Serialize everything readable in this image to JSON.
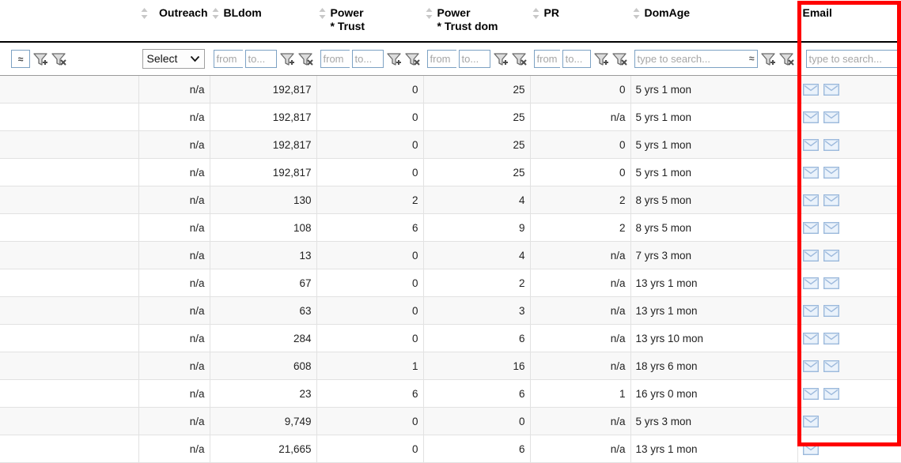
{
  "table": {
    "columns": [
      {
        "key": "check",
        "label": "",
        "align": "left",
        "sortable": false,
        "filter": "approx"
      },
      {
        "key": "outreach",
        "label": "Outreach",
        "align": "right",
        "sortable": true,
        "filter": "select"
      },
      {
        "key": "bldom",
        "label": "BLdom",
        "align": "left",
        "sortable": true,
        "filter": "range"
      },
      {
        "key": "pt",
        "label": "Power\n* Trust",
        "align": "left",
        "sortable": true,
        "filter": "range"
      },
      {
        "key": "ptd",
        "label": "Power\n* Trust dom",
        "align": "left",
        "sortable": true,
        "filter": "range"
      },
      {
        "key": "pr",
        "label": "PR",
        "align": "left",
        "sortable": true,
        "filter": "range"
      },
      {
        "key": "domage",
        "label": "DomAge",
        "align": "left",
        "sortable": true,
        "filter": "search"
      },
      {
        "key": "email",
        "label": "Email",
        "align": "left",
        "sortable": false,
        "filter": "search"
      }
    ],
    "filters": {
      "approx_label": "≈",
      "select_value": "Select",
      "select_caret": "⌵",
      "from_placeholder": "from",
      "to_placeholder": "to...",
      "search_placeholder": "type to search...",
      "search_tilde": "≈",
      "add_filter_icon": "filter-add-icon",
      "clear_filter_icon": "filter-clear-icon"
    },
    "na_text": "n/a",
    "envelope_icon": "envelope-icon",
    "rows": [
      {
        "check": "",
        "outreach": "n/a",
        "bldom": "192,817",
        "pt": "0",
        "ptd": "25",
        "pr": "0",
        "domage": "5 yrs 1 mon",
        "emails": 2
      },
      {
        "check": "",
        "outreach": "n/a",
        "bldom": "192,817",
        "pt": "0",
        "ptd": "25",
        "pr": "n/a",
        "domage": "5 yrs 1 mon",
        "emails": 2
      },
      {
        "check": "",
        "outreach": "n/a",
        "bldom": "192,817",
        "pt": "0",
        "ptd": "25",
        "pr": "0",
        "domage": "5 yrs 1 mon",
        "emails": 2
      },
      {
        "check": "",
        "outreach": "n/a",
        "bldom": "192,817",
        "pt": "0",
        "ptd": "25",
        "pr": "0",
        "domage": "5 yrs 1 mon",
        "emails": 2
      },
      {
        "check": "",
        "outreach": "n/a",
        "bldom": "130",
        "pt": "2",
        "ptd": "4",
        "pr": "2",
        "domage": "8 yrs 5 mon",
        "emails": 2
      },
      {
        "check": "",
        "outreach": "n/a",
        "bldom": "108",
        "pt": "6",
        "ptd": "9",
        "pr": "2",
        "domage": "8 yrs 5 mon",
        "emails": 2
      },
      {
        "check": "",
        "outreach": "n/a",
        "bldom": "13",
        "pt": "0",
        "ptd": "4",
        "pr": "n/a",
        "domage": "7 yrs 3 mon",
        "emails": 2
      },
      {
        "check": "",
        "outreach": "n/a",
        "bldom": "67",
        "pt": "0",
        "ptd": "2",
        "pr": "n/a",
        "domage": "13 yrs 1 mon",
        "emails": 2
      },
      {
        "check": "",
        "outreach": "n/a",
        "bldom": "63",
        "pt": "0",
        "ptd": "3",
        "pr": "n/a",
        "domage": "13 yrs 1 mon",
        "emails": 2
      },
      {
        "check": "",
        "outreach": "n/a",
        "bldom": "284",
        "pt": "0",
        "ptd": "6",
        "pr": "n/a",
        "domage": "13 yrs 10 mon",
        "emails": 2
      },
      {
        "check": "",
        "outreach": "n/a",
        "bldom": "608",
        "pt": "1",
        "ptd": "16",
        "pr": "n/a",
        "domage": "18 yrs 6 mon",
        "emails": 2
      },
      {
        "check": "",
        "outreach": "n/a",
        "bldom": "23",
        "pt": "6",
        "ptd": "6",
        "pr": "1",
        "domage": "16 yrs 0 mon",
        "emails": 2
      },
      {
        "check": "",
        "outreach": "n/a",
        "bldom": "9,749",
        "pt": "0",
        "ptd": "0",
        "pr": "n/a",
        "domage": "5 yrs 3 mon",
        "emails": 1
      },
      {
        "check": "",
        "outreach": "n/a",
        "bldom": "21,665",
        "pt": "0",
        "ptd": "6",
        "pr": "n/a",
        "domage": "13 yrs 1 mon",
        "emails": 1
      }
    ]
  },
  "annotation": {
    "highlight_color": "#ff0000",
    "highlight_target": "Email"
  }
}
